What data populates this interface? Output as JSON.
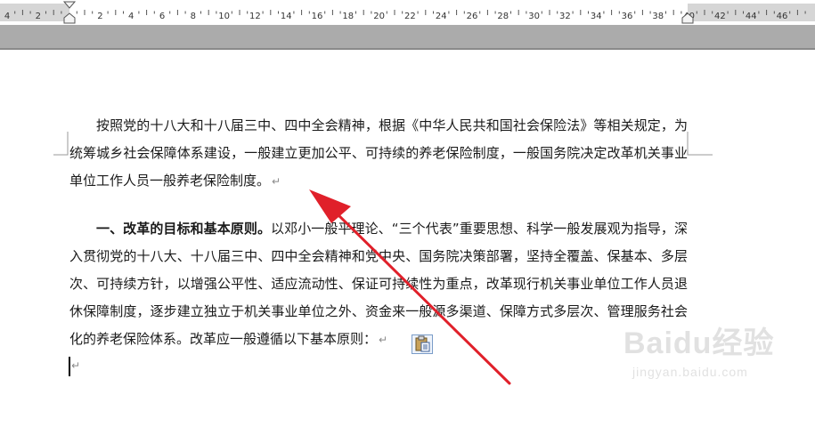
{
  "ruler": {
    "labels": [
      "4",
      "2",
      "",
      "2",
      "4",
      "6",
      "8",
      "10",
      "12",
      "14",
      "16",
      "18",
      "20",
      "22",
      "24",
      "26",
      "28",
      "30",
      "32",
      "34",
      "36",
      "38",
      "40",
      "42",
      "44",
      "46"
    ]
  },
  "document": {
    "paragraph1": "按照党的十八大和十八届三中、四中全会精神，根据《中华人民共和国社会保险法》等相关规定，为统筹城乡社会保障体系建设，一般建立更加公平、可持续的养老保险制度，一般国务院决定改革机关事业单位工作人员一般养老保险制度。",
    "paragraph2_heading": "一、改革的目标和基本原则。",
    "paragraph2_body": "以邓小一般平理论、“三个代表”重要思想、科学一般发展观为指导，深入贯彻党的十八大、十八届三中、四中全会精神和党中央、国务院决策部署，坚持全覆盖、保基本、多层次、可持续方针，以增强公平性、适应流动性、保证可持续性为重点，改革现行机关事业单位工作人员退休保障制度，逐步建立独立于机关事业单位之外、资金来一般源多渠道、保障方式多层次、管理服务社会化的养老保险体系。改革应一般遵循以下基本原则：",
    "paragraph_mark": "↵"
  },
  "watermark": {
    "brand": "Baidu经验",
    "sub": "jingyan.baidu.com"
  },
  "colors": {
    "arrow": "#e0202a",
    "toolband": "#ababab"
  }
}
